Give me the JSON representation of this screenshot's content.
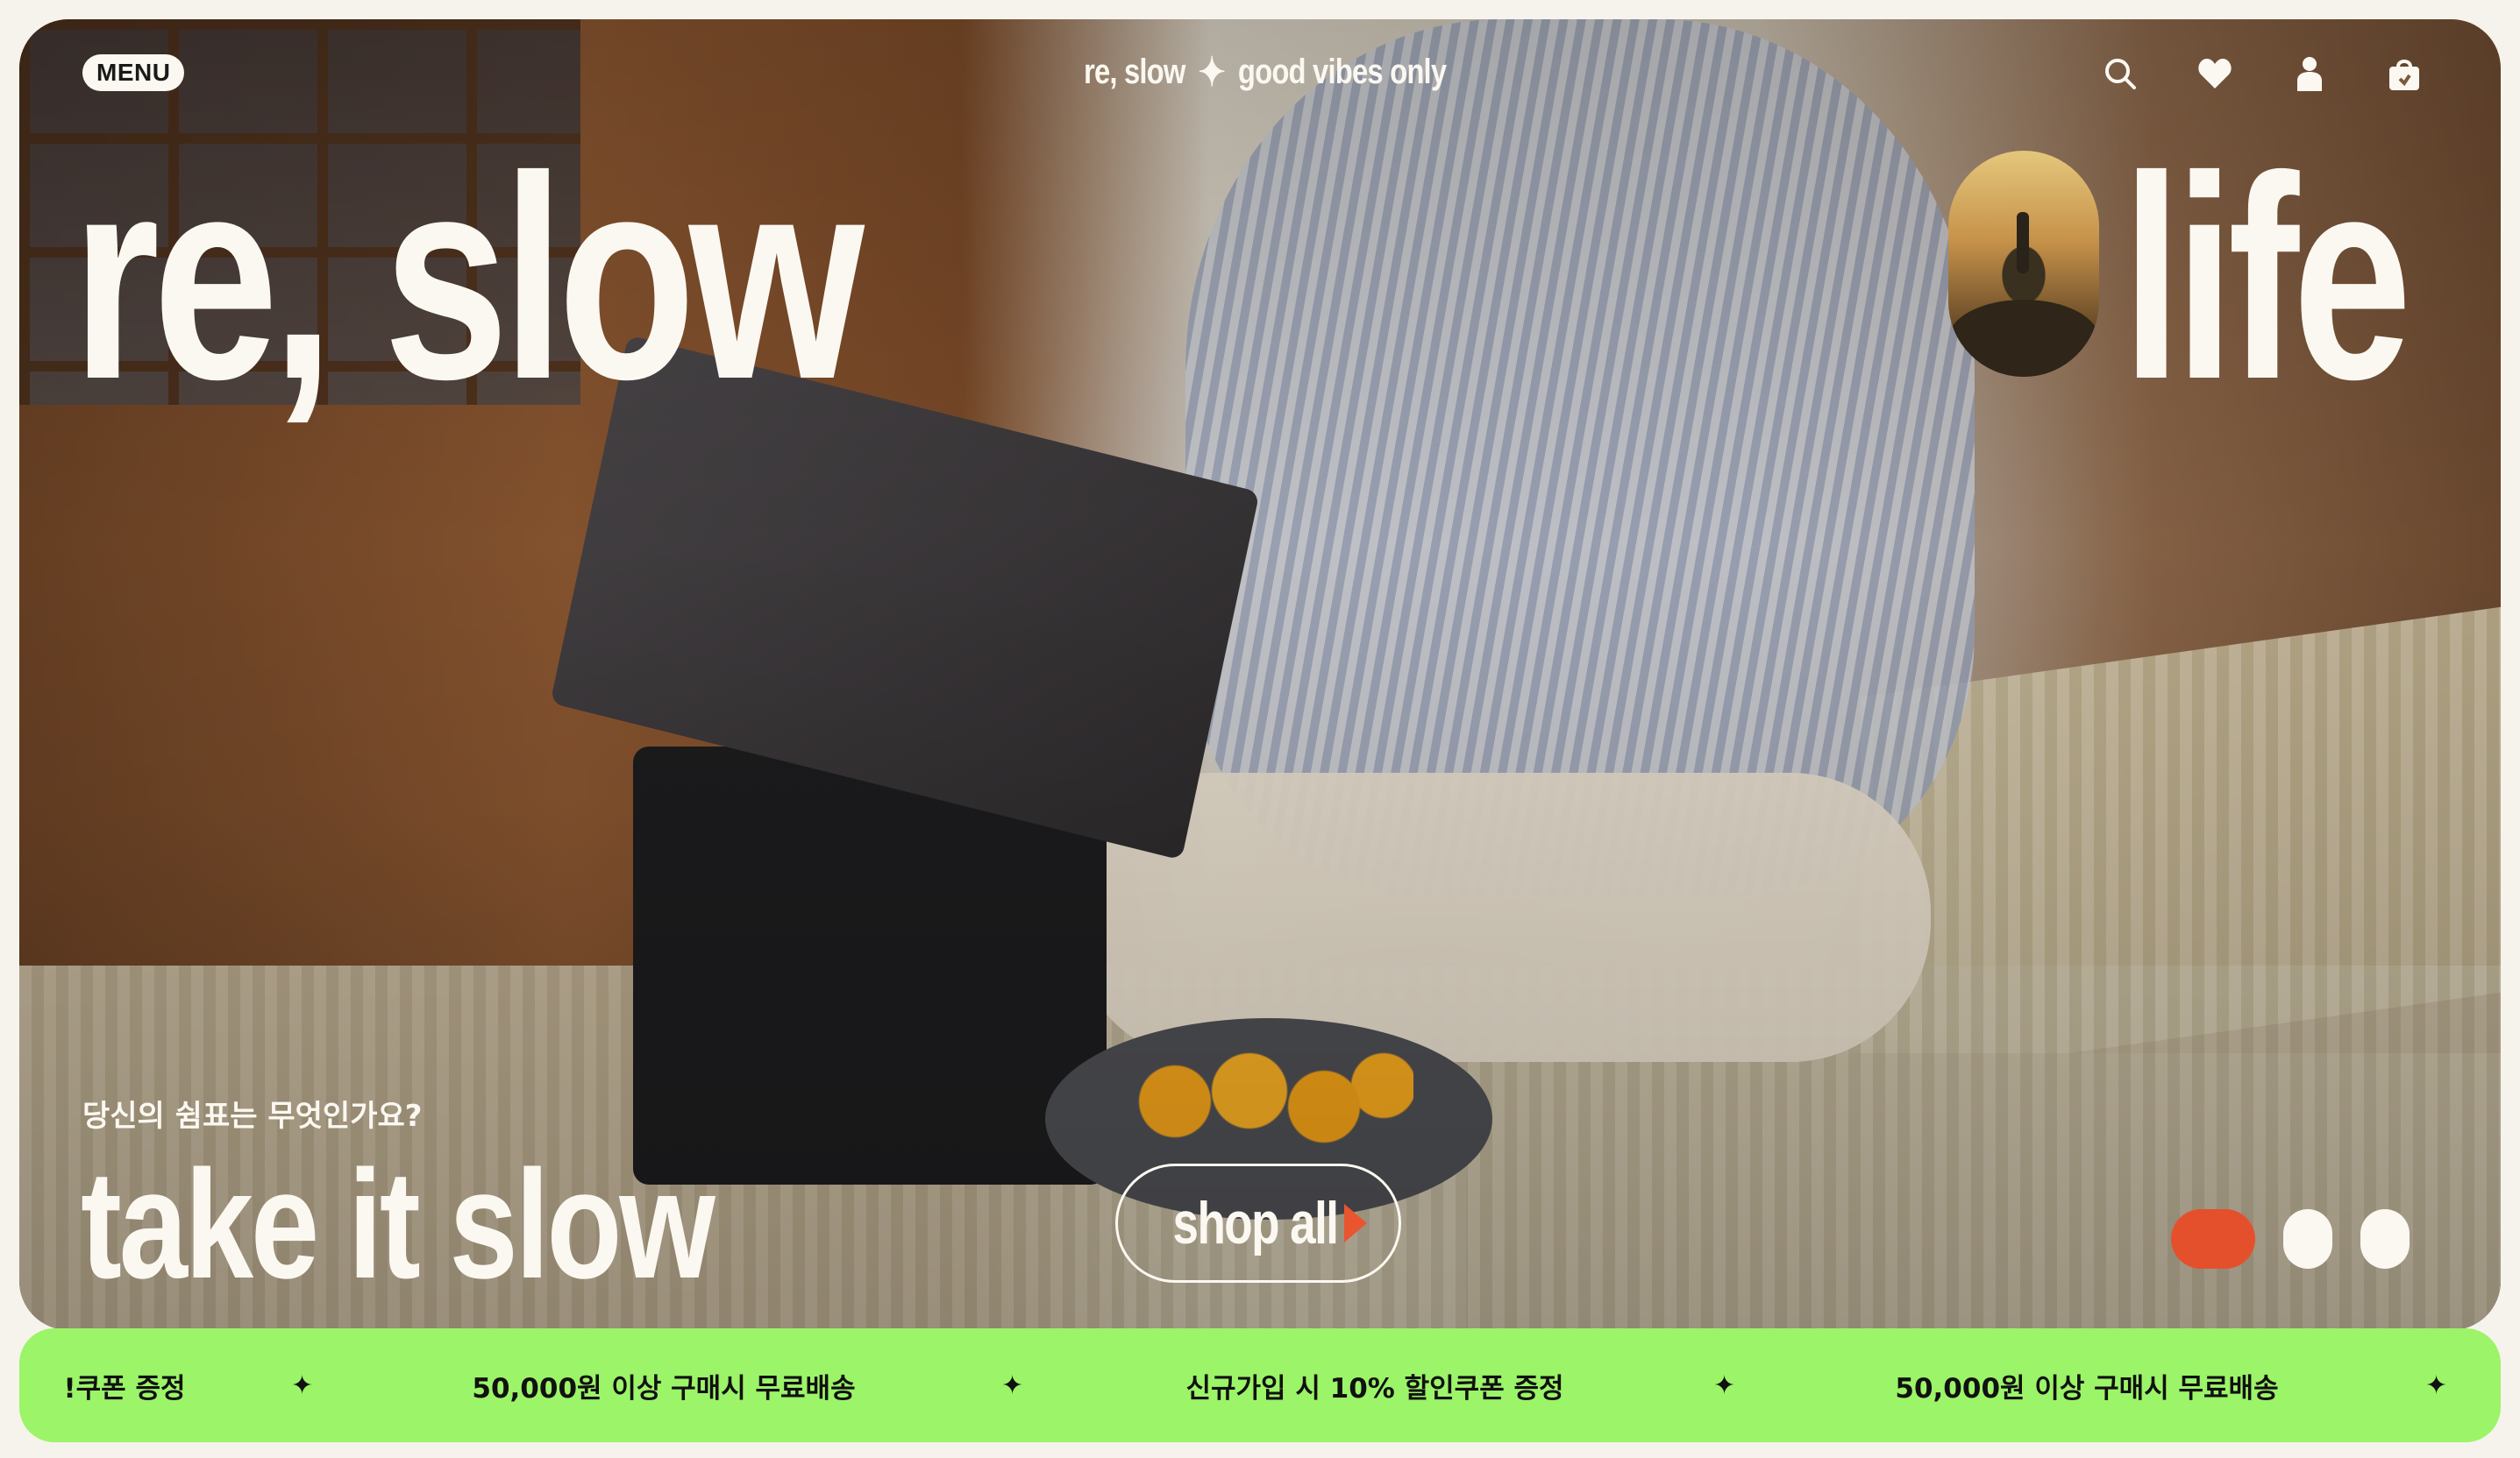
{
  "header": {
    "menu_label": "MENU",
    "tagline_left": "re, slow",
    "tagline_star": "✦",
    "tagline_right": "good vibes only",
    "icons": [
      "search-icon",
      "heart-icon",
      "user-icon",
      "shopping-bag-icon"
    ]
  },
  "hero": {
    "headline_left": "re, slow",
    "headline_right": "life",
    "question": "당신의 쉼표는 무엇인가요?",
    "slogan": "take it slow",
    "cta_label": "shop all",
    "slides_count": 3,
    "active_slide": 1,
    "accent_color": "#e5502c"
  },
  "ticker": {
    "background": "#9cf468",
    "items": [
      "!쿠폰 증정",
      "50,000원 이상 구매시 무료배송",
      "신규가입 시 10% 할인쿠폰 증정",
      "50,000원 이상 구매시 무료배송"
    ],
    "separator": "✦"
  }
}
